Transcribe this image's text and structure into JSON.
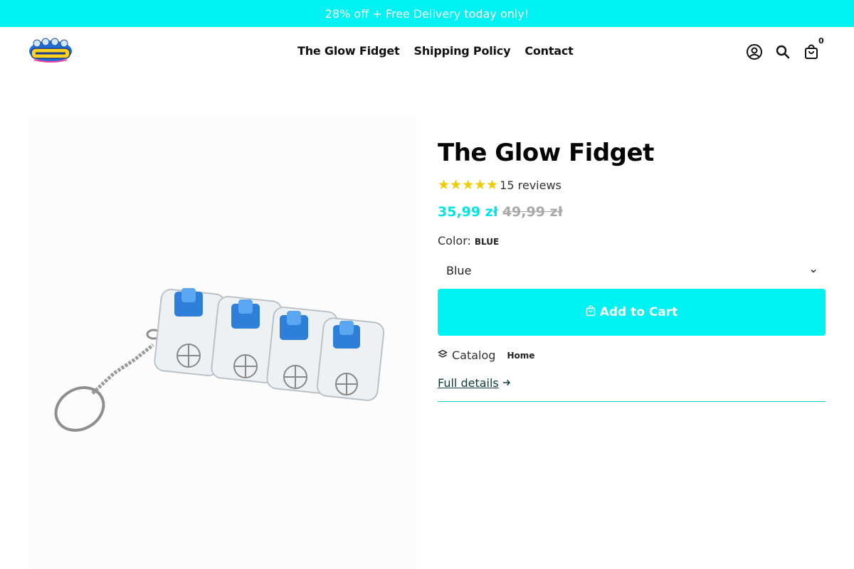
{
  "announcement": "28% off + Free Delivery today only!",
  "brand": {
    "logo_text": "GlowFidget"
  },
  "nav": [
    {
      "label": "The Glow Fidget"
    },
    {
      "label": "Shipping Policy"
    },
    {
      "label": "Contact"
    }
  ],
  "header_icons": {
    "account": "account-icon",
    "search": "search-icon",
    "cart": "cart-icon",
    "cart_count": "0"
  },
  "product": {
    "title": "The Glow Fidget",
    "stars": "★★★★★",
    "rating_value": 5,
    "reviews": "15 reviews",
    "price_sale": "35,99 zł",
    "price_compare": "49,99 zł",
    "color_label": "Color:",
    "color_value": "Blue",
    "selected_option": "Blue",
    "add_to_cart": "Add to Cart",
    "catalog_label": "Catalog",
    "catalog_link": "Home",
    "full_details": "Full details"
  },
  "colors": {
    "accent": "#00f2f2",
    "star": "#f2cc00",
    "price_sale": "#00e5e5",
    "price_old": "#a8a8a8"
  }
}
